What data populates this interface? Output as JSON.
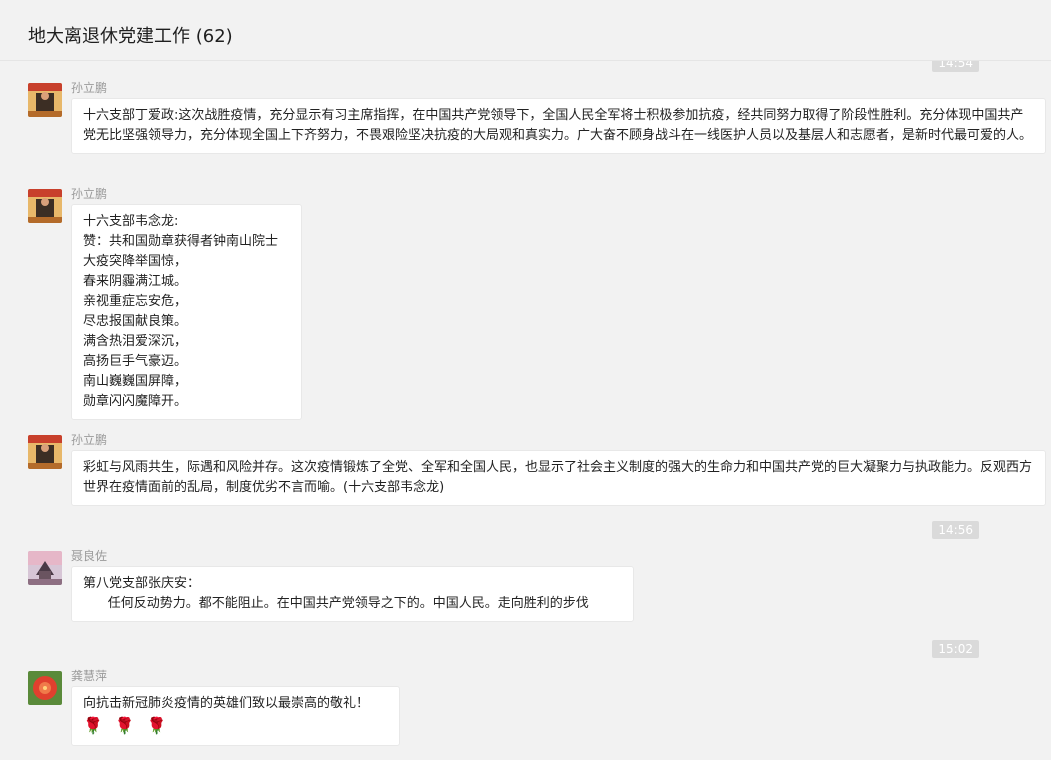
{
  "window": {
    "title": "地大离退休党建工作 (62)"
  },
  "times": {
    "t0": "14:54",
    "t1": "14:56",
    "t2": "15:02"
  },
  "messages": [
    {
      "sender": "孙立鹏",
      "text": "十六支部丁爱政:这次战胜疫情，充分显示有习主席指挥，在中国共产党领导下，全国人民全军将士积极参加抗疫，经共同努力取得了阶段性胜利。充分体现中国共产党无比坚强领导力，充分体现全国上下齐努力，不畏艰险坚决抗疫的大局观和真实力。广大奋不顾身战斗在一线医护人员以及基层人和志愿者，是新时代最可爱的人。"
    },
    {
      "sender": "孙立鹏",
      "lines": [
        "十六支部韦念龙:",
        "赞：共和国勋章获得者钟南山院士",
        "大疫突降举国惊，",
        "春来阴霾满江城。",
        "亲视重症忘安危，",
        "尽忠报国献良策。",
        "满含热泪爱深沉，",
        "高扬巨手气豪迈。",
        "南山巍巍国屏障，",
        "勋章闪闪魔障开。"
      ]
    },
    {
      "sender": "孙立鹏",
      "text": "彩虹与风雨共生，际遇和风险并存。这次疫情锻炼了全党、全军和全国人民，也显示了社会主义制度的强大的生命力和中国共产党的巨大凝聚力与执政能力。反观西方世界在疫情面前的乱局，制度优劣不言而喻。(十六支部韦念龙)"
    },
    {
      "sender": "聂良佐",
      "lines": [
        "第八党支部张庆安：",
        "      任何反动势力。都不能阻止。在中国共产党领导之下的。中国人民。走向胜利的步伐"
      ]
    },
    {
      "sender": "龚慧萍",
      "text": "向抗击新冠肺炎疫情的英雄们致以最崇高的敬礼！",
      "emojis": [
        "🌹",
        "🌹",
        "🌹"
      ]
    }
  ]
}
